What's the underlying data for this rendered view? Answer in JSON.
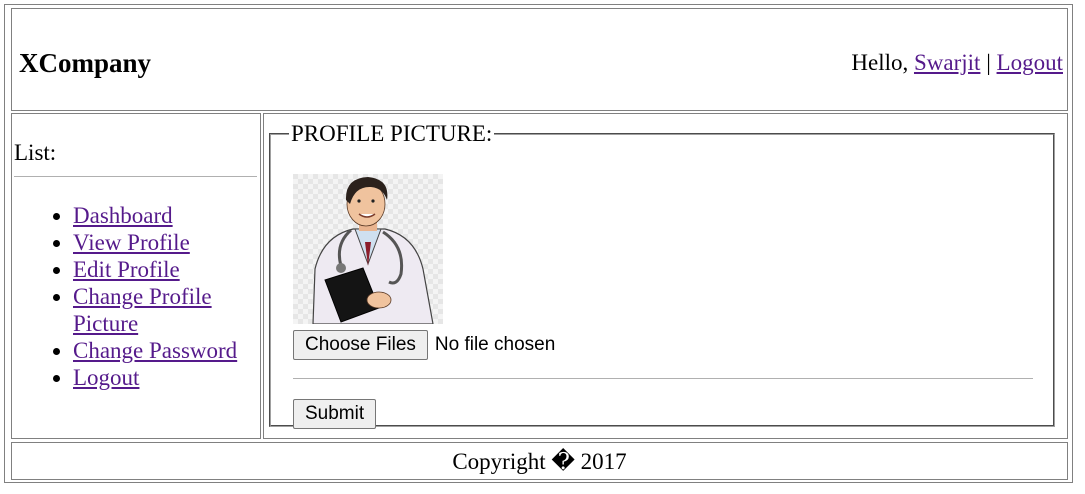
{
  "header": {
    "brand": "XCompany",
    "greeting_prefix": "Hello,",
    "username": "Swarjit",
    "separator": "|",
    "logout": "Logout"
  },
  "sidebar": {
    "title": "List:",
    "items": [
      {
        "label": "Dashboard"
      },
      {
        "label": "View Profile"
      },
      {
        "label": "Edit Profile"
      },
      {
        "label": "Change Profile Picture"
      },
      {
        "label": "Change Password"
      },
      {
        "label": "Logout"
      }
    ]
  },
  "main": {
    "legend": "PROFILE PICTURE:",
    "choose_files": "Choose Files",
    "file_status": "No file chosen",
    "submit": "Submit"
  },
  "footer": {
    "copyright": "Copyright � 2017"
  }
}
